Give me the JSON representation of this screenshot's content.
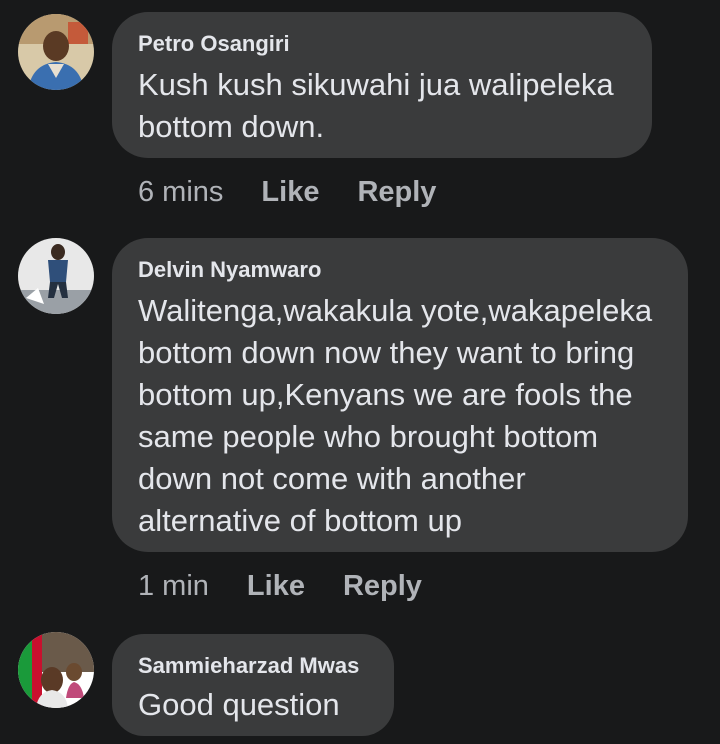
{
  "comments": [
    {
      "author": "Petro Osangiri",
      "text": "Kush kush sikuwahi jua walipeleka\nbottom down.",
      "time": "6 mins",
      "like_label": "Like",
      "reply_label": "Reply"
    },
    {
      "author": "Delvin Nyamwaro",
      "text": "Walitenga,wakakula yote,wakapeleka\nbottom down now they want to bring\nbottom up,Kenyans we are fools the\nsame people who brought bottom\ndown not come with another\nalternative of bottom up",
      "time": "1 min",
      "like_label": "Like",
      "reply_label": "Reply"
    },
    {
      "author": "Sammieharzad Mwas",
      "text": "Good question"
    }
  ],
  "colors": {
    "background": "#18191a",
    "bubble": "#3a3b3c",
    "text": "#e4e6eb",
    "secondary": "#b0b3b8"
  }
}
